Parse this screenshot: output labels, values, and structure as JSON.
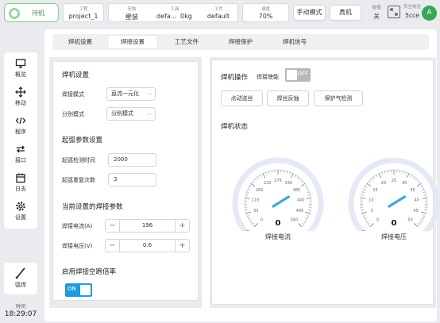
{
  "topbar": {
    "status": "待机",
    "project_label": "工程",
    "project_value": "project_1",
    "install_label": "安装",
    "install_value": "壁装",
    "tool_label": "工具",
    "tool_value": "defa...",
    "tool_weight": "0kg",
    "workpiece_label": "工件",
    "workpiece_value": "default",
    "speed_label": "速度",
    "speed_value": "70%",
    "mode_button": "手动模式",
    "real_button": "真机",
    "collision_label": "碰撞",
    "collision_value": "关",
    "safety_label": "安全校验",
    "safety_value": "5cce",
    "avatar_letter": "A"
  },
  "sidebar": {
    "items": [
      {
        "label": "概览",
        "icon": "monitor-icon"
      },
      {
        "label": "移动",
        "icon": "move-icon"
      },
      {
        "label": "程序",
        "icon": "code-icon"
      },
      {
        "label": "接口",
        "icon": "interface-icon"
      },
      {
        "label": "日志",
        "icon": "calendar-icon"
      },
      {
        "label": "设置",
        "icon": "gear-icon"
      }
    ],
    "weld_label": "弧焊",
    "time_label": "时间",
    "time_value": "18:29:07"
  },
  "tabs": [
    "焊机设置",
    "焊接设置",
    "工艺文件",
    "焊接保护",
    "焊机信号"
  ],
  "active_tab": 1,
  "left": {
    "welder_settings_title": "焊机设置",
    "weld_mode_label": "焊接模式",
    "weld_mode_value": "直流一元化",
    "split_mode_label": "分别模式",
    "split_mode_value": "分别模式",
    "arc_title": "起弧参数设置",
    "arc_detect_label": "起弧检测时间",
    "arc_detect_value": "2000",
    "arc_retry_label": "起弧重复次数",
    "arc_retry_value": "3",
    "current_params_title": "当前设置的焊接参数",
    "current_label": "焊接电流(A)",
    "current_value": "196",
    "voltage_label": "焊接电压(V)",
    "voltage_value": "0.6",
    "dry_run_title": "启用焊接空跑倍率",
    "dry_run_toggle": "ON"
  },
  "right": {
    "op_title": "焊机操作",
    "enable_label": "焊接使能",
    "enable_toggle": "OFF",
    "buttons": [
      "点动送丝",
      "焊丝反抽",
      "保护气检测"
    ],
    "status_title": "焊机状态",
    "gauge_current": {
      "label": "焊接电流",
      "value": "0",
      "ticks": [
        "0",
        "55",
        "110",
        "165",
        "220",
        "275",
        "330",
        "385",
        "440",
        "495",
        "550"
      ]
    },
    "gauge_voltage": {
      "label": "焊接电压",
      "value": "0",
      "ticks": [
        "0",
        "5",
        "10",
        "15",
        "20",
        "25",
        "30",
        "35",
        "40",
        "45",
        "50"
      ]
    }
  }
}
